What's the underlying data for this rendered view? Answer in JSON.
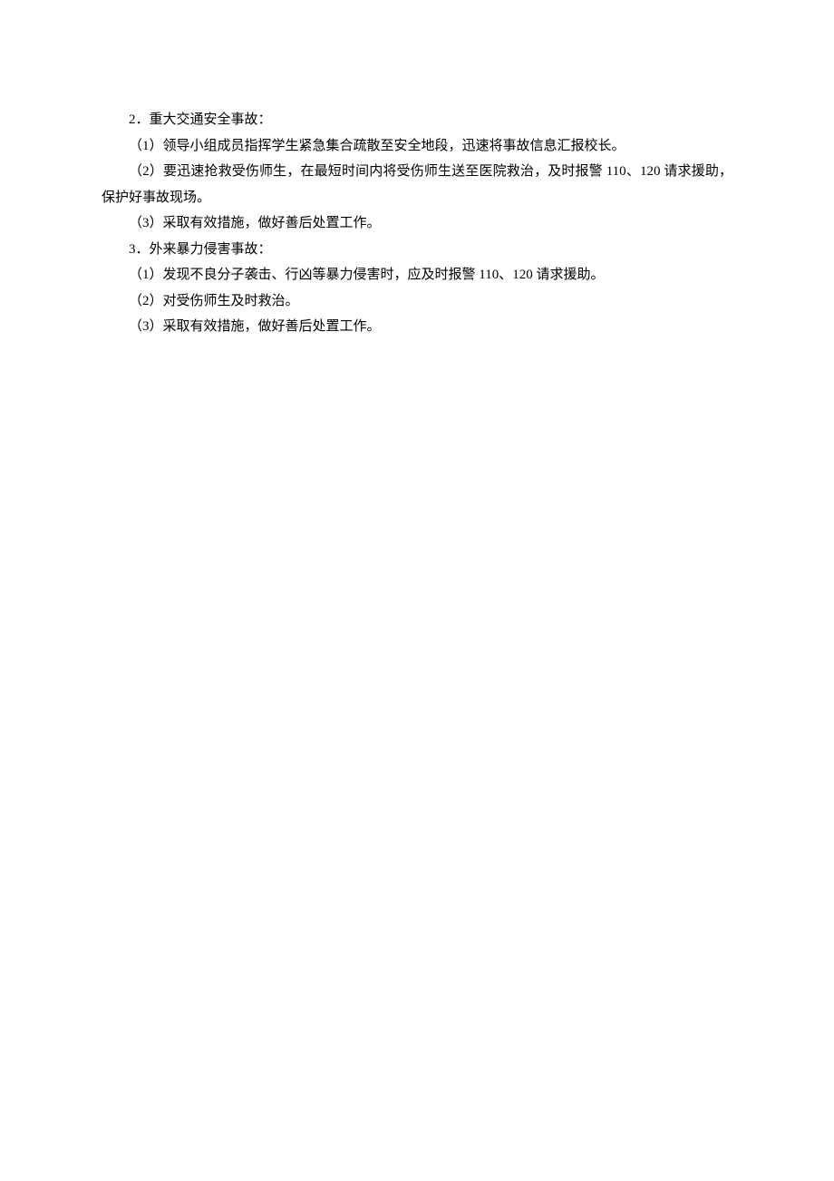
{
  "sections": [
    {
      "header": "2．重大交通安全事故：",
      "items": [
        "（1）领导小组成员指挥学生紧急集合疏散至安全地段，迅速将事故信息汇报校长。",
        "（2）要迅速抢救受伤师生，在最短时间内将受伤师生送至医院救治，及时报警 110、120 请求援助，保护好事故现场。",
        "（3）采取有效措施，做好善后处置工作。"
      ]
    },
    {
      "header": "3．外来暴力侵害事故：",
      "items": [
        "（1）发现不良分子袭击、行凶等暴力侵害时，应及时报警 110、120 请求援助。",
        "（2）对受伤师生及时救治。",
        "（3）采取有效措施，做好善后处置工作。"
      ]
    }
  ]
}
